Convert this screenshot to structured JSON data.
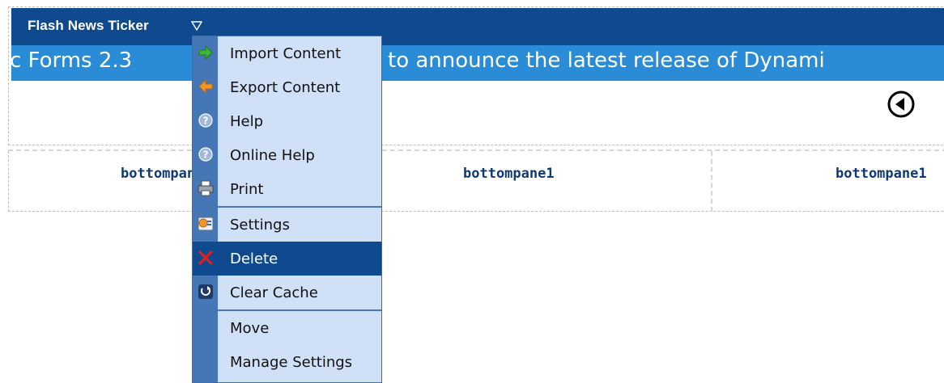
{
  "module": {
    "title": "Flash News Ticker",
    "ticker_text_left": "c Forms 2.3",
    "ticker_text_right": "to announce the latest release of Dynami"
  },
  "panes": [
    {
      "label": "bottompane1"
    },
    {
      "label": "bottompane1"
    },
    {
      "label": "bottompane1"
    }
  ],
  "menu": {
    "items": [
      {
        "label": "Import Content",
        "icon": "import-arrow-icon"
      },
      {
        "label": "Export Content",
        "icon": "export-arrow-icon"
      },
      {
        "label": "Help",
        "icon": "help-icon"
      },
      {
        "label": "Online Help",
        "icon": "online-help-icon"
      },
      {
        "label": "Print",
        "icon": "print-icon"
      },
      {
        "label": "Settings",
        "icon": "settings-icon"
      },
      {
        "label": "Delete",
        "icon": "delete-icon",
        "selected": true
      },
      {
        "label": "Clear Cache",
        "icon": "refresh-icon"
      },
      {
        "label": "Move",
        "icon": ""
      },
      {
        "label": "Manage Settings",
        "icon": ""
      }
    ]
  },
  "colors": {
    "header_bg": "#0f4a8f",
    "ticker_bg": "#2a8bd6",
    "menu_bg": "#cfe0f7",
    "menu_gutter": "#4577b6",
    "menu_selected": "#0f4a8f"
  }
}
